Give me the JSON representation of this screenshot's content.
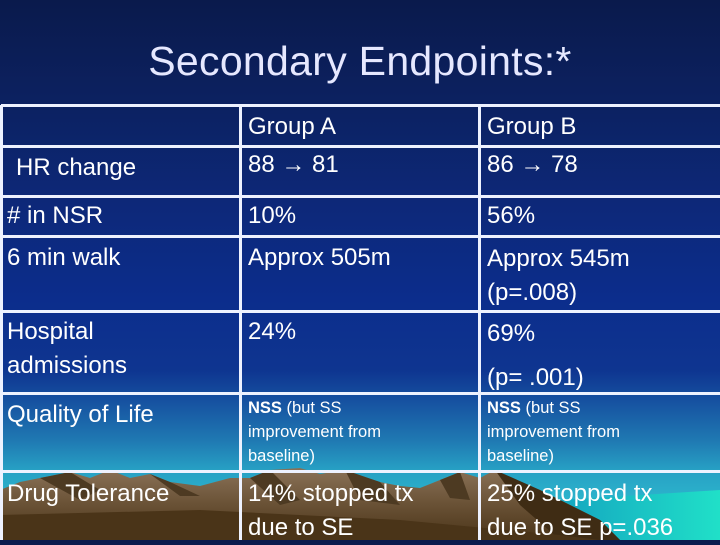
{
  "slide": {
    "title": "Secondary Endpoints:*"
  },
  "table": {
    "columns": [
      "",
      "Group A",
      "Group B"
    ],
    "rows": [
      {
        "label": "HR change",
        "group_a": {
          "from": "88",
          "arrow": "→",
          "to": "81"
        },
        "group_b": {
          "from": "86",
          "arrow": "→",
          "to": "78"
        }
      },
      {
        "label": "# in NSR",
        "group_a": "10%",
        "group_b": "56%"
      },
      {
        "label": "6 min walk",
        "group_a": "Approx 505m",
        "group_b": "Approx 545m",
        "group_b_note": "(p=.008)"
      },
      {
        "label_lines": [
          "Hospital",
          "admissions"
        ],
        "group_a": "24%",
        "group_b": "69%",
        "group_b_note": "(p= .001)"
      },
      {
        "label": "Quality of Life",
        "group_a": {
          "bold": "NSS",
          "rest_line1": " (but SS",
          "line2": "improvement from",
          "line3": "baseline)"
        },
        "group_b": {
          "bold": "NSS",
          "rest_line1": " (but SS",
          "line2": "improvement from",
          "line3": "baseline)"
        }
      },
      {
        "label": "Drug Tolerance",
        "group_a": {
          "line1": "14% stopped tx",
          "line2": "due to SE"
        },
        "group_b": {
          "line1": "25% stopped tx",
          "line2": "due to SE p=.036"
        }
      }
    ]
  },
  "colors": {
    "title_text": "#e6e8ff",
    "grid_lines": "#eef2ff",
    "bg_top": "#0a1a4c",
    "bg_mid": "#0c2d8c",
    "bg_sky_teal": "#2cb4cc",
    "mountain_dark": "#4a3418",
    "mountain_light": "#8a7258"
  }
}
